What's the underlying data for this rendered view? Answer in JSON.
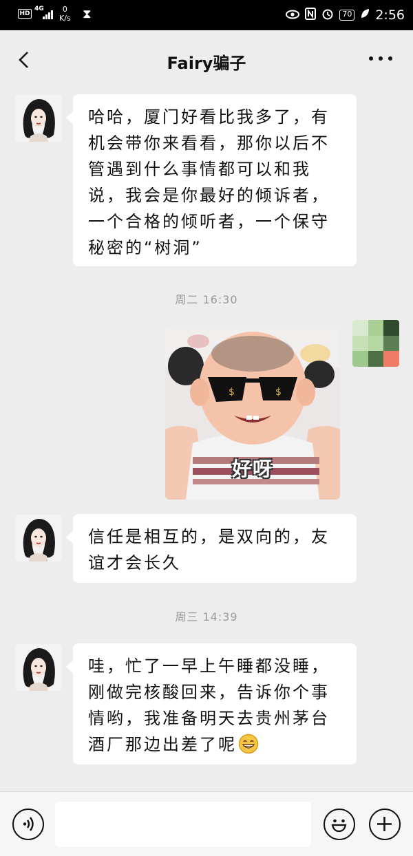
{
  "status_bar": {
    "hd_label": "HD",
    "network": "4G",
    "speed_value": "0",
    "speed_unit": "K/s",
    "battery": "70",
    "time": "2:56",
    "icons": [
      "hourglass-icon",
      "eye-icon",
      "nfc-icon",
      "alarm-icon",
      "battery-icon",
      "leaf-icon"
    ]
  },
  "header": {
    "title": "Fairy骗子",
    "back_icon": "chevron-left-icon",
    "more_icon": "more-dots-icon"
  },
  "messages": [
    {
      "type": "text",
      "side": "left",
      "text": "哈哈，厦门好看比我多了，有机会带你来看看，那你以后不管遇到什么事情都可以和我说，我会是你最好的倾诉者，一个合格的倾听者，一个保守秘密的“树洞”"
    },
    {
      "type": "timestamp",
      "text": "周二 16:30"
    },
    {
      "type": "sticker",
      "side": "right",
      "caption": "好呀"
    },
    {
      "type": "text",
      "side": "left",
      "text": "信任是相互的，是双向的，友谊才会长久"
    },
    {
      "type": "timestamp",
      "text": "周三 14:39"
    },
    {
      "type": "text",
      "side": "left",
      "text": "哇，忙了一早上午睡都没睡，刚做完核酸回来，告诉你个事情哟，我准备明天去贵州茅台酒厂那边出差了呢",
      "emoji": "grin"
    }
  ],
  "bottom_bar": {
    "voice_icon": "voice-icon",
    "input_value": "",
    "emoji_icon": "emoji-icon",
    "plus_icon": "plus-icon"
  },
  "colors": {
    "background": "#ededed",
    "bubble": "#ffffff",
    "timestamp": "#9a9a9a",
    "right_avatar_mosaic": [
      "#d9ead0",
      "#a9cf94",
      "#2f4a2d",
      "#c7e0b8",
      "#b6d7a4",
      "#5d7d55",
      "#9fc98c",
      "#4f7047",
      "#f07b66"
    ]
  }
}
